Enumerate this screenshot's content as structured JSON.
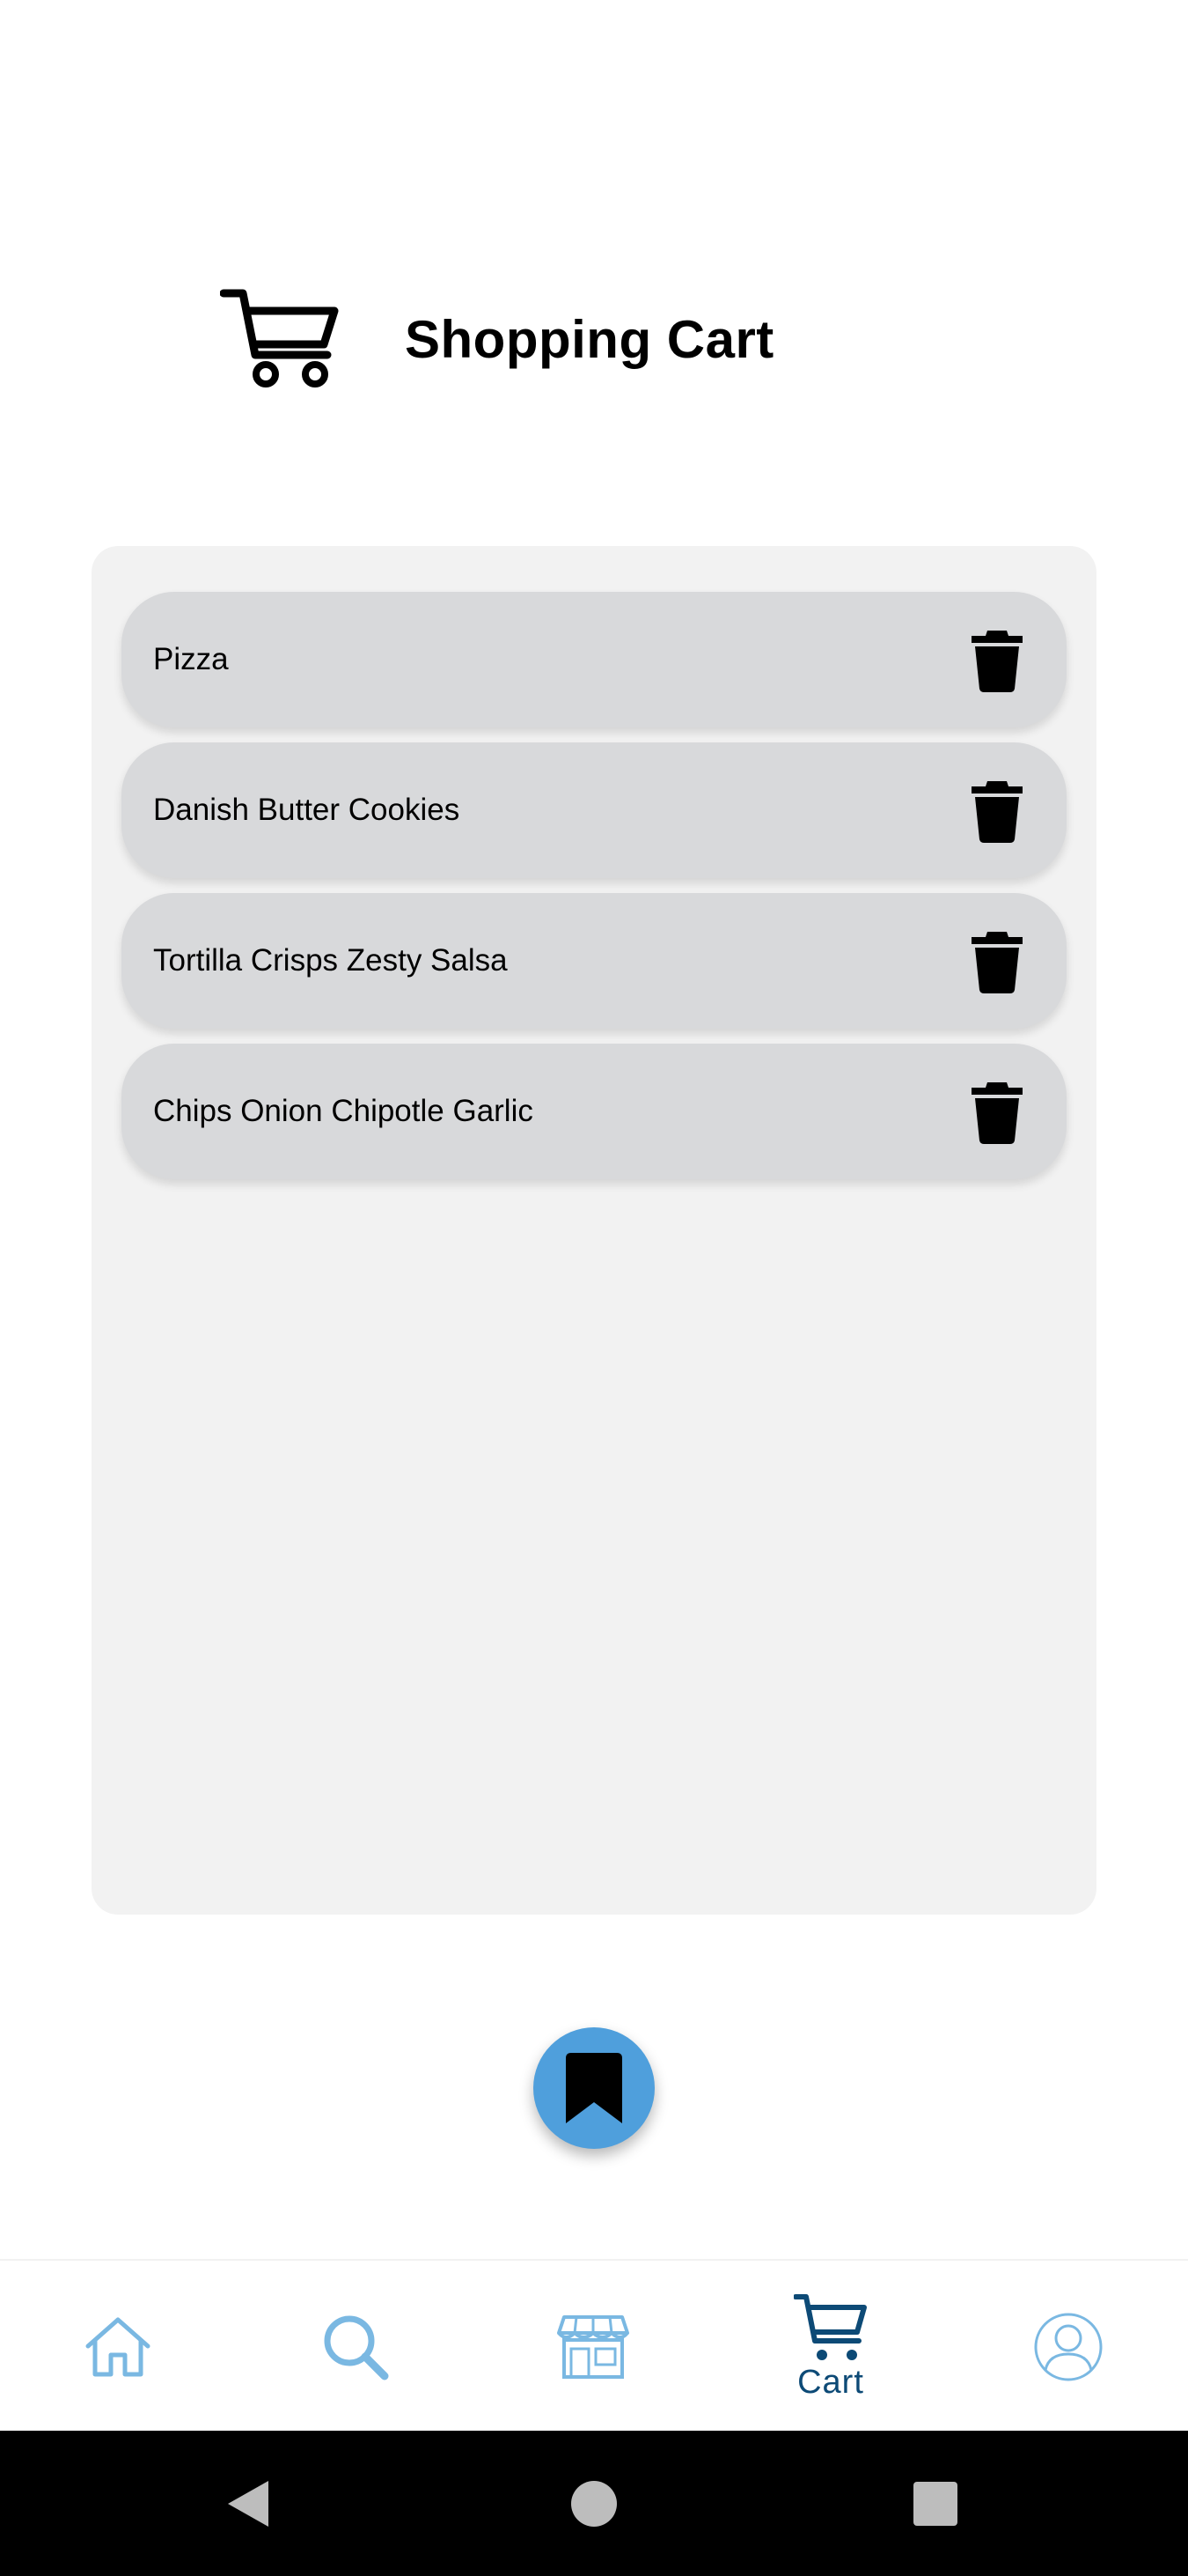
{
  "header": {
    "title": "Shopping Cart",
    "icon": "shopping-cart-icon"
  },
  "cart": {
    "items": [
      {
        "name": "Pizza"
      },
      {
        "name": "Danish Butter Cookies"
      },
      {
        "name": "Tortilla Crisps Zesty Salsa"
      },
      {
        "name": "Chips Onion Chipotle Garlic"
      }
    ],
    "delete_icon": "trash-icon"
  },
  "fab": {
    "icon": "bookmark-icon"
  },
  "bottom_nav": {
    "items": [
      {
        "id": "home",
        "icon": "home-icon",
        "label": ""
      },
      {
        "id": "search",
        "icon": "search-icon",
        "label": ""
      },
      {
        "id": "store",
        "icon": "store-icon",
        "label": ""
      },
      {
        "id": "cart",
        "icon": "cart-icon",
        "label": "Cart",
        "active": true
      },
      {
        "id": "profile",
        "icon": "profile-icon",
        "label": ""
      }
    ]
  },
  "system_bar": {
    "buttons": [
      "back-icon",
      "home-circle-icon",
      "recents-icon"
    ]
  },
  "colors": {
    "accent": "#4f9fdc",
    "nav_icon": "#7ab8e2",
    "nav_active": "#0d4a76",
    "item_bg": "#d8d9db",
    "panel_bg": "#f2f2f2"
  }
}
